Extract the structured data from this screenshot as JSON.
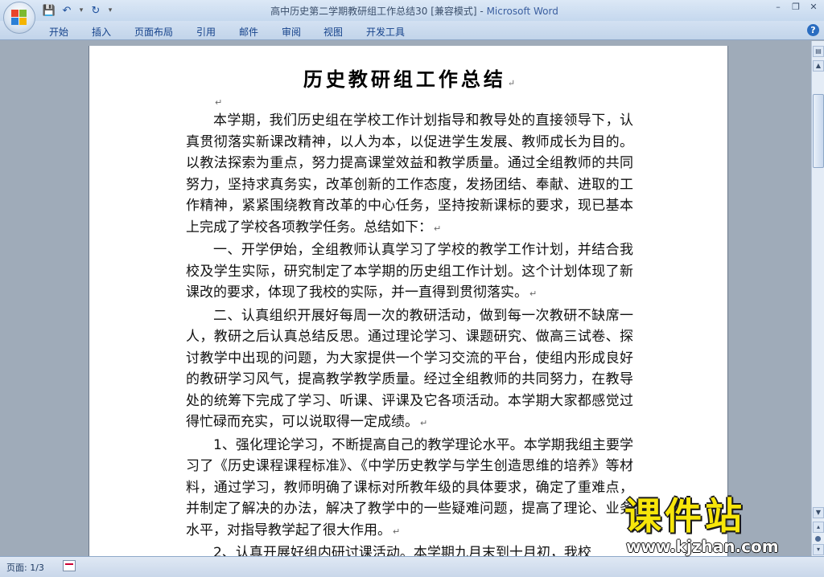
{
  "window": {
    "title": "高中历史第二学期教研组工作总结30 [兼容模式] - ",
    "app_name": "Microsoft Word",
    "minimize": "–",
    "restore": "❐",
    "close": "✕"
  },
  "qat": {
    "save_glyph": "💾",
    "undo_glyph": "↶",
    "dropdown_glyph": "▾",
    "redo_glyph": "↻",
    "customize_glyph": "▾"
  },
  "tabs": [
    {
      "label": "开始"
    },
    {
      "label": "插入"
    },
    {
      "label": "页面布局"
    },
    {
      "label": "引用"
    },
    {
      "label": "邮件"
    },
    {
      "label": "审阅"
    },
    {
      "label": "视图"
    },
    {
      "label": "开发工具"
    }
  ],
  "help_label": "?",
  "document": {
    "title": "历史教研组工作总结",
    "paragraph_mark": "↵",
    "paragraphs": [
      "本学期，我们历史组在学校工作计划指导和教导处的直接领导下，认真贯彻落实新课改精神，以人为本，以促进学生发展、教师成长为目的。以教法探索为重点，努力提高课堂效益和教学质量。通过全组教师的共同努力，坚持求真务实，改革创新的工作态度，发扬团结、奉献、进取的工作精神，紧紧围绕教育改革的中心任务，坚持按新课标的要求，现已基本上完成了学校各项教学任务。总结如下：",
      "一、开学伊始，全组教师认真学习了学校的教学工作计划，并结合我校及学生实际，研究制定了本学期的历史组工作计划。这个计划体现了新课改的要求，体现了我校的实际，并一直得到贯彻落实。",
      "二、认真组织开展好每周一次的教研活动，做到每一次教研不缺席一人，教研之后认真总结反思。通过理论学习、课题研究、做高三试卷、探讨教学中出现的问题，为大家提供一个学习交流的平台，使组内形成良好的教研学习风气，提高教学教学质量。经过全组教师的共同努力，在教导处的统筹下完成了学习、听课、评课及它各项活动。本学期大家都感觉过得忙碌而充实，可以说取得一定成绩。",
      "1、强化理论学习，不断提高自己的教学理论水平。本学期我组主要学习了《历史课程课程标准》、《中学历史教学与学生创造思维的培养》等材料，通过学习，教师明确了课标对所教年级的具体要求，确定了重难点，并制定了解决的办法，解决了教学中的一些疑难问题，提高了理论、业务水平，对指导教学起了很大作用。",
      "2、认真开展好组内研讨课活动。本学期九月末到十月初，我校"
    ]
  },
  "watermark": {
    "text": "课件站",
    "url": "www.kjzhan.com"
  },
  "statusbar": {
    "page": "页面: 1/3"
  },
  "colors": {
    "ribbon_text": "#15428b",
    "watermark_fill": "#f7e60a"
  }
}
